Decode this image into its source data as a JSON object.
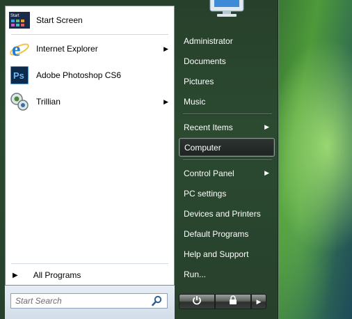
{
  "left_items": [
    {
      "label": "Start Screen",
      "icon": "start-screen-icon",
      "submenu": false
    },
    {
      "label": "Internet Explorer",
      "icon": "internet-explorer-icon",
      "submenu": true
    },
    {
      "label": "Adobe Photoshop CS6",
      "icon": "photoshop-icon",
      "submenu": false
    },
    {
      "label": "Trillian",
      "icon": "trillian-icon",
      "submenu": true
    }
  ],
  "start_tile_text": "Start",
  "photoshop_text": "Ps",
  "all_programs": "All Programs",
  "search": {
    "placeholder": "Start Search"
  },
  "right_items": [
    {
      "label": "Administrator",
      "submenu": false
    },
    {
      "label": "Documents",
      "submenu": false
    },
    {
      "label": "Pictures",
      "submenu": false
    },
    {
      "label": "Music",
      "submenu": false
    },
    {
      "label": "Recent Items",
      "submenu": true
    },
    {
      "label": "Computer",
      "submenu": false,
      "highlighted": true
    },
    {
      "label": "Control Panel",
      "submenu": true
    },
    {
      "label": "PC settings",
      "submenu": false
    },
    {
      "label": "Devices and Printers",
      "submenu": false
    },
    {
      "label": "Default Programs",
      "submenu": false
    },
    {
      "label": "Help and Support",
      "submenu": false
    },
    {
      "label": "Run...",
      "submenu": false
    }
  ],
  "arrow_glyph": "▶",
  "power_buttons": [
    "power-icon",
    "lock-icon",
    "arrow-right-icon"
  ],
  "colors": {
    "menu_bg": "#2b4a30",
    "left_pane_bg": "#ffffff",
    "right_text": "#ffffff",
    "ie_blue": "#1e7fd4",
    "ps_blue": "#0d2a4a"
  }
}
